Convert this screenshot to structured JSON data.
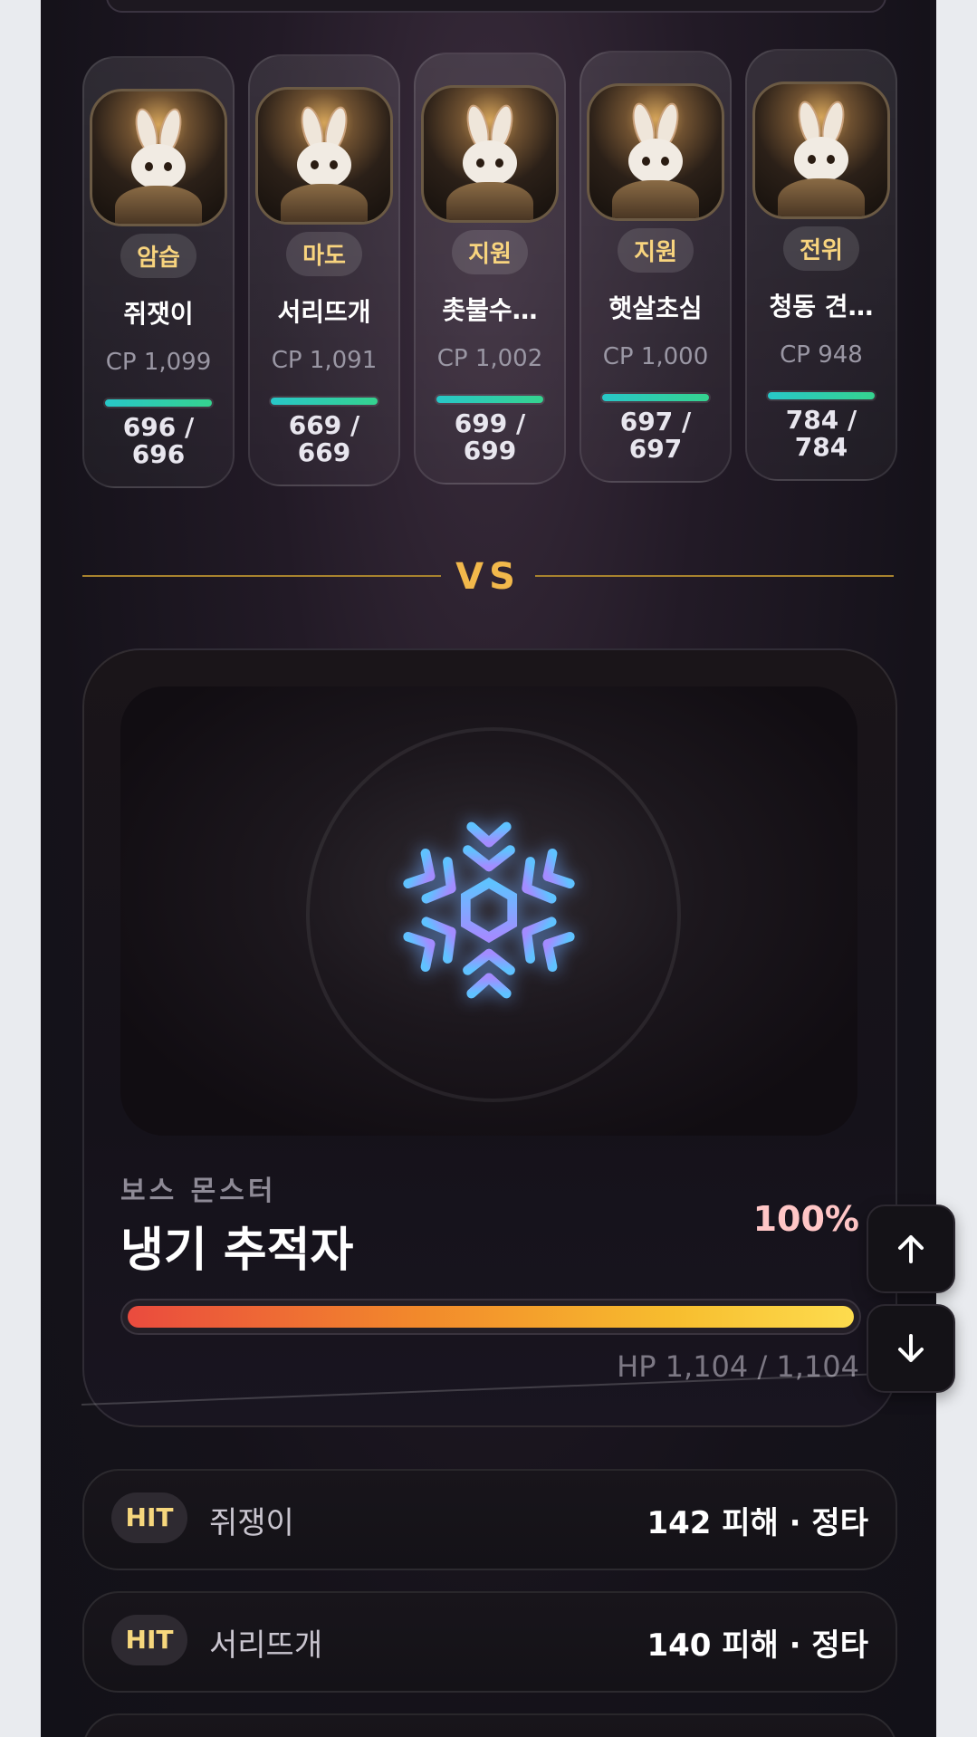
{
  "party": [
    {
      "role": "암습",
      "name": "쥐잿이",
      "cp": "CP 1,099",
      "hp": "696 /\n696"
    },
    {
      "role": "마도",
      "name": "서리뜨개",
      "cp": "CP 1,091",
      "hp": "669 /\n669"
    },
    {
      "role": "지원",
      "name": "촛불수…",
      "cp": "CP 1,002",
      "hp": "699 /\n699"
    },
    {
      "role": "지원",
      "name": "햇살초심",
      "cp": "CP 1,000",
      "hp": "697 /\n697"
    },
    {
      "role": "전위",
      "name": "청동 견…",
      "cp": "CP 948",
      "hp": "784 /\n784"
    }
  ],
  "vs_label": "VS",
  "boss": {
    "label": "보스 몬스터",
    "name": "냉기 추적자",
    "percent": "100%",
    "hp_fraction": 1.0,
    "hp_text": "HP 1,104 / 1,104",
    "icon": "snowflake-icon"
  },
  "log": [
    {
      "badge": "HIT",
      "name": "쥐쟁이",
      "damage": "142 피해 · 정타"
    },
    {
      "badge": "HIT",
      "name": "서리뜨개",
      "damage": "140 피해 · 정타"
    }
  ],
  "controls": {
    "up_icon": "arrow-up-icon",
    "down_icon": "arrow-down-icon"
  },
  "colors": {
    "accent_gold": "#f2b84b",
    "role_text": "#f8d47e",
    "hp_bar": "#28c7c8",
    "boss_pct": "#ffc6c6"
  }
}
